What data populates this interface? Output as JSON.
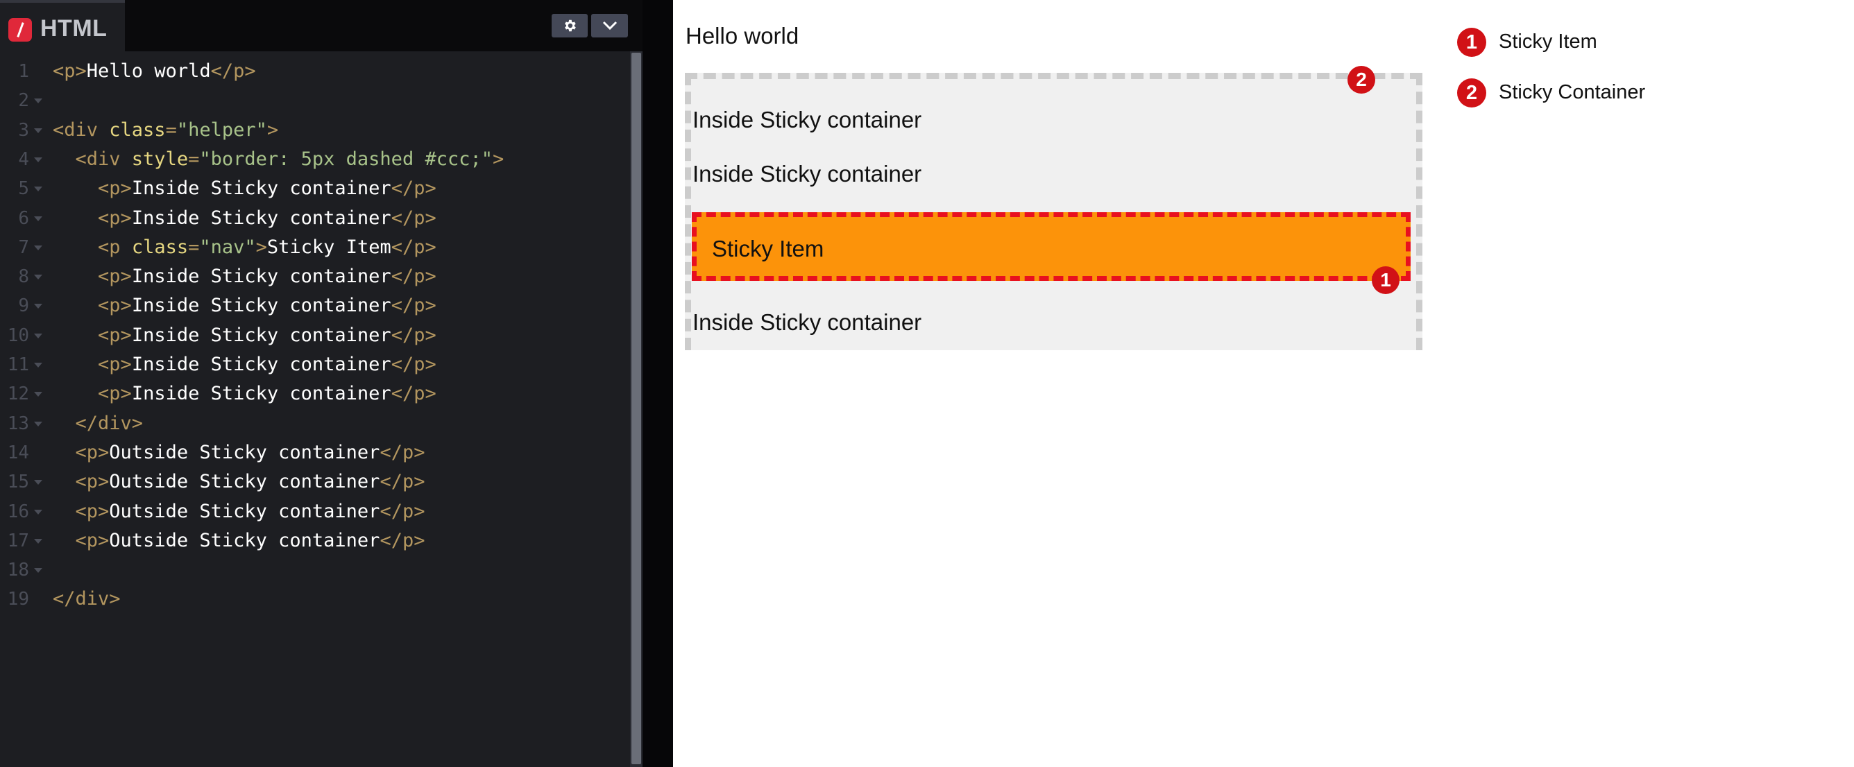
{
  "editor": {
    "language_label": "HTML",
    "settings_icon": "gear-icon",
    "collapse_icon": "chevron-down-icon",
    "lines": [
      [
        [
          "t",
          "<p>"
        ],
        [
          "x",
          "Hello world"
        ],
        [
          "t",
          "</p>"
        ]
      ],
      [],
      [
        [
          "t",
          "<div "
        ],
        [
          "a",
          "class"
        ],
        [
          "t",
          "="
        ],
        [
          "s",
          "\"helper\""
        ],
        [
          "t",
          ">"
        ]
      ],
      [
        [
          "x",
          "  "
        ],
        [
          "t",
          "<div "
        ],
        [
          "a",
          "style"
        ],
        [
          "t",
          "="
        ],
        [
          "s",
          "\"border: 5px dashed #ccc;\""
        ],
        [
          "t",
          ">"
        ]
      ],
      [
        [
          "x",
          "    "
        ],
        [
          "t",
          "<p>"
        ],
        [
          "x",
          "Inside Sticky container"
        ],
        [
          "t",
          "</p>"
        ]
      ],
      [
        [
          "x",
          "    "
        ],
        [
          "t",
          "<p>"
        ],
        [
          "x",
          "Inside Sticky container"
        ],
        [
          "t",
          "</p>"
        ]
      ],
      [
        [
          "x",
          "    "
        ],
        [
          "t",
          "<p "
        ],
        [
          "a",
          "class"
        ],
        [
          "t",
          "="
        ],
        [
          "s",
          "\"nav\""
        ],
        [
          "t",
          ">"
        ],
        [
          "x",
          "Sticky Item"
        ],
        [
          "t",
          "</p>"
        ]
      ],
      [
        [
          "x",
          "    "
        ],
        [
          "t",
          "<p>"
        ],
        [
          "x",
          "Inside Sticky container"
        ],
        [
          "t",
          "</p>"
        ]
      ],
      [
        [
          "x",
          "    "
        ],
        [
          "t",
          "<p>"
        ],
        [
          "x",
          "Inside Sticky container"
        ],
        [
          "t",
          "</p>"
        ]
      ],
      [
        [
          "x",
          "    "
        ],
        [
          "t",
          "<p>"
        ],
        [
          "x",
          "Inside Sticky container"
        ],
        [
          "t",
          "</p>"
        ]
      ],
      [
        [
          "x",
          "    "
        ],
        [
          "t",
          "<p>"
        ],
        [
          "x",
          "Inside Sticky container"
        ],
        [
          "t",
          "</p>"
        ]
      ],
      [
        [
          "x",
          "    "
        ],
        [
          "t",
          "<p>"
        ],
        [
          "x",
          "Inside Sticky container"
        ],
        [
          "t",
          "</p>"
        ]
      ],
      [
        [
          "x",
          "  "
        ],
        [
          "t",
          "</div>"
        ]
      ],
      [
        [
          "x",
          "  "
        ],
        [
          "t",
          "<p>"
        ],
        [
          "x",
          "Outside Sticky container"
        ],
        [
          "t",
          "</p>"
        ]
      ],
      [
        [
          "x",
          "  "
        ],
        [
          "t",
          "<p>"
        ],
        [
          "x",
          "Outside Sticky container"
        ],
        [
          "t",
          "</p>"
        ]
      ],
      [
        [
          "x",
          "  "
        ],
        [
          "t",
          "<p>"
        ],
        [
          "x",
          "Outside Sticky container"
        ],
        [
          "t",
          "</p>"
        ]
      ],
      [
        [
          "x",
          "  "
        ],
        [
          "t",
          "<p>"
        ],
        [
          "x",
          "Outside Sticky container"
        ],
        [
          "t",
          "</p>"
        ]
      ],
      [],
      [
        [
          "t",
          "</div>"
        ]
      ]
    ],
    "fold_lines": [
      1,
      2,
      3,
      4,
      5,
      6,
      7,
      8,
      9,
      10,
      11,
      12,
      14,
      15,
      16,
      17
    ]
  },
  "preview": {
    "hello": "Hello world",
    "inside_1": "Inside Sticky container",
    "inside_2": "Inside Sticky container",
    "sticky_item": "Sticky Item",
    "inside_3": "Inside Sticky container",
    "marker_item": "1",
    "marker_container": "2"
  },
  "legend": [
    {
      "number": "1",
      "label": "Sticky Item"
    },
    {
      "number": "2",
      "label": "Sticky Container"
    }
  ],
  "colors": {
    "sticky_item_bg": "#fc930a",
    "sticky_item_border": "#e8101f",
    "container_border": "#cccccc",
    "marker": "#d11116"
  }
}
